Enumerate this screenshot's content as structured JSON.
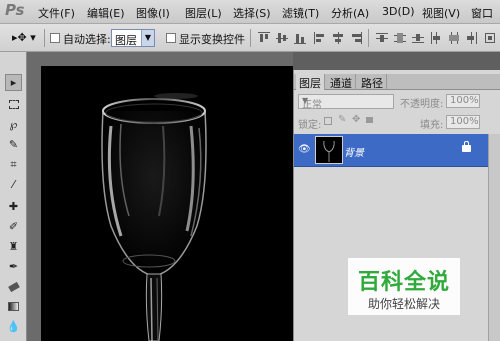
{
  "app": {
    "logo": "Ps"
  },
  "menu": [
    "文件(F)",
    "编辑(E)",
    "图像(I)",
    "图层(L)",
    "选择(S)",
    "滤镜(T)",
    "分析(A)",
    "3D(D)",
    "视图(V)",
    "窗口"
  ],
  "options": {
    "move_tool_glyph": "▸✥ ▾",
    "auto_select_label": "自动选择:",
    "auto_select_value": "图层",
    "show_transform_label": "显示变换控件"
  },
  "layers_panel": {
    "tabs": [
      "图层",
      "通道",
      "路径"
    ],
    "blend_mode": "正常",
    "opacity_label": "不透明度:",
    "opacity_value": "100%",
    "lock_label": "锁定:",
    "fill_label": "填充:",
    "fill_value": "100%",
    "layer_name": "背景"
  },
  "watermark": {
    "title": "百科全说",
    "subtitle": "助你轻松解决"
  },
  "colors": {
    "selection": "#3c6ac5",
    "watermark_green": "#2faa3b"
  }
}
